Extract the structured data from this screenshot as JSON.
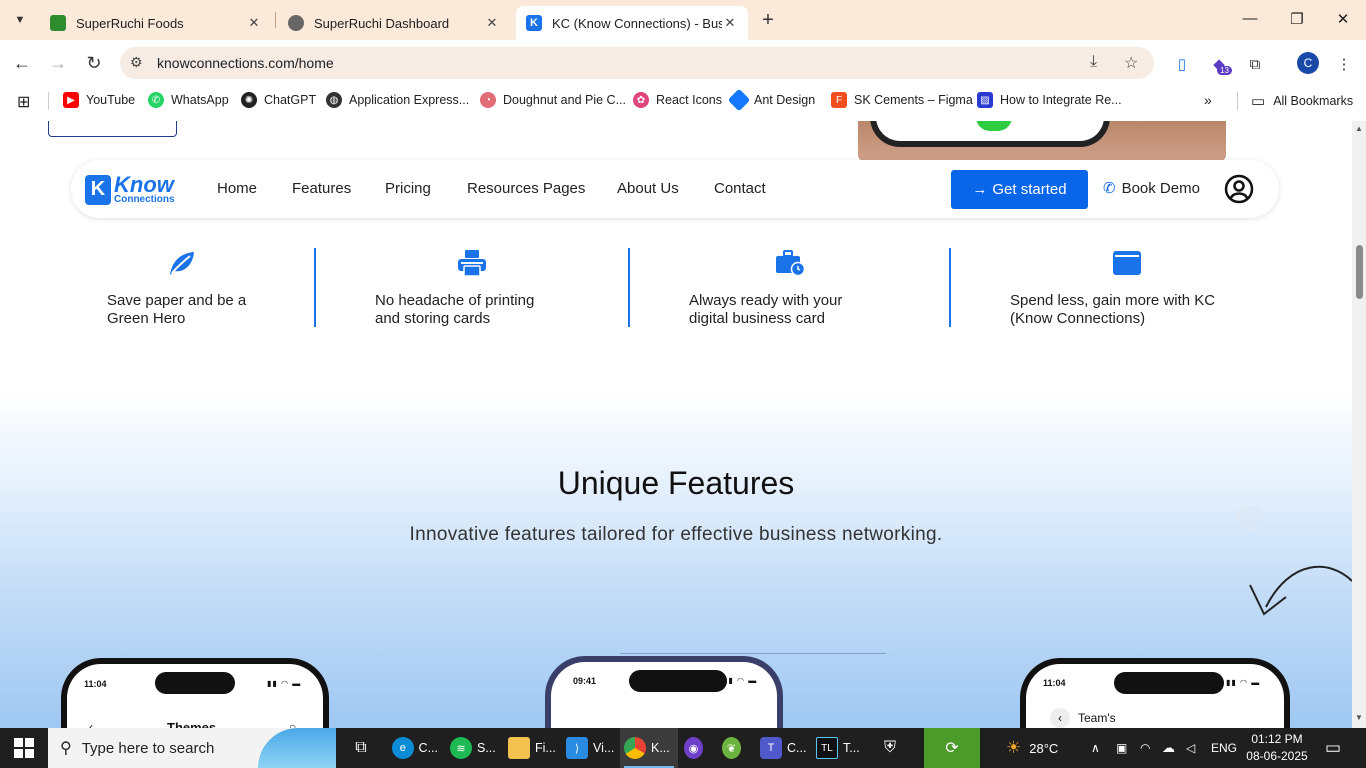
{
  "browser": {
    "tabs": [
      {
        "title": "SuperRuchi Foods",
        "active": false
      },
      {
        "title": "SuperRuchi Dashboard",
        "active": false
      },
      {
        "title": "KC (Know Connections) - Business",
        "active": true
      }
    ],
    "url": "knowconnections.com/home",
    "profile_initial": "C",
    "extension_badge": "13",
    "bookmarks": [
      "YouTube",
      "WhatsApp",
      "ChatGPT",
      "Application Express...",
      "Doughnut and Pie C...",
      "React Icons",
      "Ant Design",
      "SK Cements – Figma",
      "How to Integrate Re..."
    ],
    "all_bookmarks": "All Bookmarks"
  },
  "site": {
    "logo": {
      "word1": "Know",
      "word2": "Connections"
    },
    "nav": [
      "Home",
      "Features",
      "Pricing",
      "Resources Pages",
      "About Us",
      "Contact"
    ],
    "get_started": "Get started",
    "book_demo": "Book Demo",
    "benefits": [
      {
        "line1": "Save paper and be a",
        "line2": "Green Hero",
        "icon": "leaf-icon"
      },
      {
        "line1": "No headache of printing",
        "line2": "and storing cards",
        "icon": "printer-icon"
      },
      {
        "line1": "Always ready with your",
        "line2": "digital business card",
        "icon": "briefcase-clock-icon"
      },
      {
        "line1": "Spend less, gain more with KC",
        "line2": "(Know Connections)",
        "icon": "wallet-icon"
      }
    ],
    "features_title": "Unique Features",
    "features_subtitle": "Innovative features tailored for effective business networking.",
    "phones": [
      {
        "time": "11:04",
        "title": "Themes"
      },
      {
        "time": "09:41",
        "title": ""
      },
      {
        "time": "11:04",
        "title": "Team's"
      }
    ],
    "accent": "#0a66e8"
  },
  "taskbar": {
    "search_placeholder": "Type here to search",
    "apps": [
      "C...",
      "S...",
      "Fi...",
      "Vi...",
      "K...",
      "",
      "",
      "C...",
      "T..."
    ],
    "weather": "28°C",
    "language": "ENG",
    "time": "01:12 PM",
    "date": "08-06-2025"
  }
}
